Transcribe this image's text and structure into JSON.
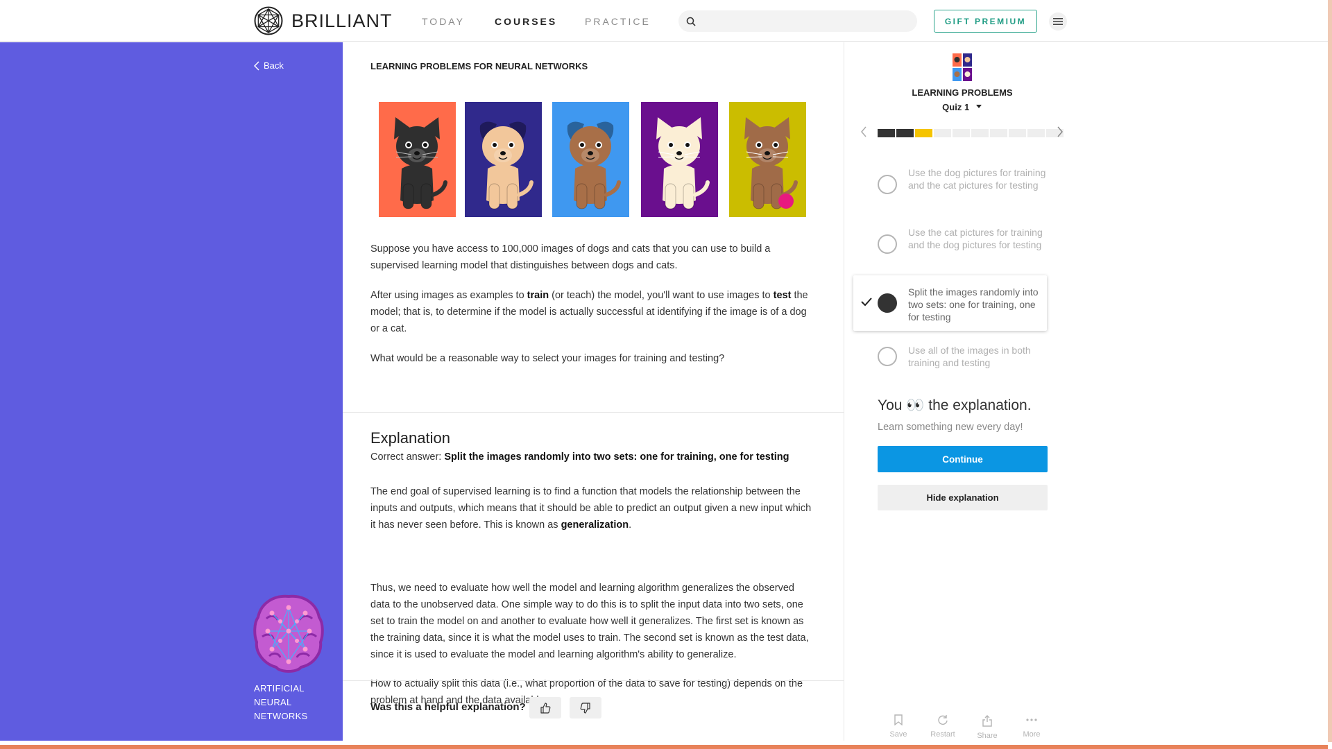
{
  "header": {
    "brand": "BRILLIANT",
    "nav": [
      {
        "label": "TODAY"
      },
      {
        "label": "COURSES"
      },
      {
        "label": "PRACTICE"
      }
    ],
    "search_placeholder": "",
    "gift_label": "GIFT PREMIUM"
  },
  "sidebar": {
    "back_label": "Back",
    "course_name": "ARTIFICIAL NEURAL NETWORKS"
  },
  "problem": {
    "title": "LEARNING PROBLEMS FOR NEURAL NETWORKS",
    "pets": [
      {
        "animal": "cat",
        "bg": "#ff6b4a",
        "fur": "#2f2f2f"
      },
      {
        "animal": "dog",
        "bg": "#30298c",
        "fur": "#f2c79b"
      },
      {
        "animal": "dog",
        "bg": "#3f98f0",
        "fur": "#a86f48"
      },
      {
        "animal": "cat",
        "bg": "#6a0f8e",
        "fur": "#fbeed5"
      },
      {
        "animal": "cat",
        "bg": "#cbbd00",
        "fur": "#a06b48"
      }
    ],
    "para1": "Suppose you have access to 100,000 images of dogs and cats that you can use to build a supervised learning model that distinguishes between dogs and cats.",
    "para2_a": "After using images as examples to ",
    "para2_train": "train",
    "para2_b": " (or teach) the model, you'll want to use images to ",
    "para2_test": "test",
    "para2_c": " the model; that is, to determine if the model is actually successful at identifying if the image is of a dog or a cat.",
    "question": "What would be a reasonable way to select your images for training and testing?"
  },
  "explanation": {
    "heading": "Explanation",
    "correct_prefix": "Correct answer: ",
    "correct_answer": "Split the images randomly into two sets: one for training, one for testing",
    "p1_a": "The end goal of supervised learning is to find a function that models the relationship between the inputs and outputs, which means that it should be able to predict an output given a new input which it has never seen before. This is known as ",
    "p1_bold": "generalization",
    "p1_b": ".",
    "p2": "Thus, we need to evaluate how well the model and learning algorithm generalizes the observed data to the unobserved data. One simple way to do this is to split the input data into two sets, one set to train the model on and another to evaluate how well it generalizes. The first set is known as the training data, since it is what the model uses to train. The second set is known as the test data, since it is used to evaluate the model and learning algorithm's ability to generalize.",
    "p3": "How to actually split this data (i.e., what proportion of the data to save for testing) depends on the problem at hand and the data available.",
    "helpful_question": "Was this a helpful explanation?"
  },
  "quiz": {
    "heading": "LEARNING PROBLEMS",
    "selector": "Quiz 1",
    "progress": {
      "total": 10,
      "done": 2,
      "current": 3,
      "done_color": "#333333",
      "current_color": "#f5c400",
      "todo_color": "#eeeeee"
    },
    "options": [
      {
        "text": "Use the dog pictures for training and the cat pictures for testing",
        "selected": false
      },
      {
        "text": "Use the cat pictures for training and the dog pictures for testing",
        "selected": false
      },
      {
        "text": "Split the images randomly into two sets: one for training, one for testing",
        "selected": true
      },
      {
        "text": "Use all of the images in both training and testing",
        "selected": false
      }
    ],
    "you_prefix": "You",
    "you_emoji": "👀",
    "you_suffix": "the explanation.",
    "learn_line": "Learn something new every day!",
    "continue_label": "Continue",
    "hide_label": "Hide explanation"
  },
  "toolbar": {
    "save": "Save",
    "restart": "Restart",
    "share": "Share",
    "more": "More"
  },
  "colors": {
    "sidebar_bg": "#5f5ce0",
    "accent_blue": "#0b96e3",
    "gift_green": "#2aa38b",
    "bottom_strip": "#e8825a"
  }
}
